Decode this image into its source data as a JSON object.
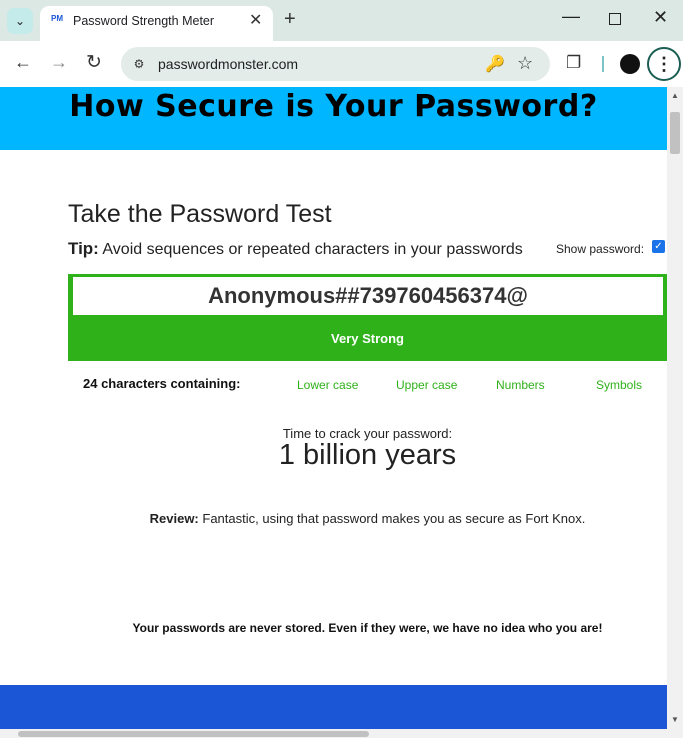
{
  "browser": {
    "tab": {
      "favicon_text": "PM",
      "title": "Password Strength Meter"
    },
    "url": "passwordmonster.com",
    "icons": {
      "tab_menu": "chevron-down-icon",
      "close": "close-icon",
      "new_tab": "plus-icon",
      "back": "arrow-left-icon",
      "forward": "arrow-right-icon",
      "reload": "reload-icon",
      "site_info": "tune-icon",
      "password_key": "key-icon",
      "bookmark": "star-icon",
      "extensions": "puzzle-icon",
      "menu": "kebab-menu-icon"
    }
  },
  "page": {
    "hero_title": "How Secure is Your Password?",
    "section_title": "Take the Password Test",
    "tip_label": "Tip:",
    "tip_text": "Avoid sequences or repeated characters in your passwords",
    "show_password_label": "Show password:",
    "show_password_checked": true,
    "password_value": "Anonymous##739760456374@",
    "strength_label": "Very Strong",
    "char_count_text": "24 characters containing:",
    "char_classes": [
      "Lower case",
      "Upper case",
      "Numbers",
      "Symbols"
    ],
    "crack_label": "Time to crack your password:",
    "crack_value": "1 billion years",
    "review_label": "Review:",
    "review_text": "Fantastic, using that password makes you as secure as Fort Knox.",
    "footer_note": "Your passwords are never stored. Even if they were, we have no idea who you are!"
  },
  "colors": {
    "hero_bg": "#00b6ff",
    "strength_green": "#2fb11a",
    "bottom_band": "#1a56d6"
  }
}
